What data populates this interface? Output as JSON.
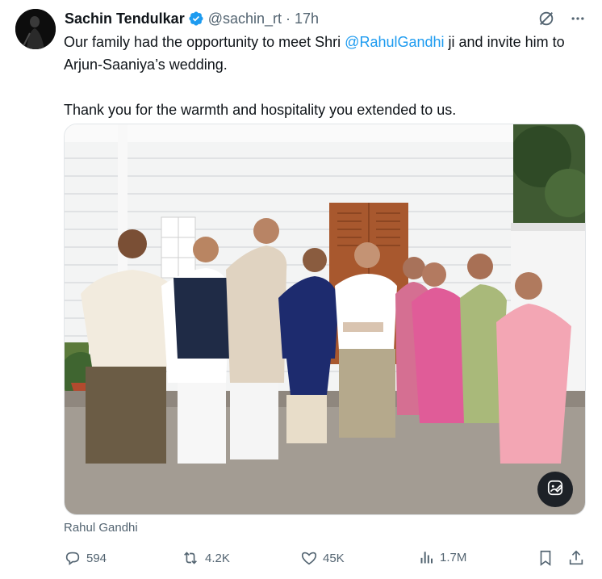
{
  "author": {
    "name": "Sachin Tendulkar",
    "handle": "@sachin_rt",
    "separator": "·",
    "time": "17h"
  },
  "tweet": {
    "text_before_mention": "Our family had the opportunity to meet Shri ",
    "mention": "@RahulGandhi",
    "text_after_mention": " ji and invite him to Arjun-Saaniya’s wedding.",
    "second_paragraph": "Thank you for the warmth and hospitality you extended to us."
  },
  "tagged_user": "Rahul Gandhi",
  "actions": {
    "replies": "594",
    "reposts": "4.2K",
    "likes": "45K",
    "views": "1.7M"
  },
  "icons": {
    "verified": "verified-badge-icon",
    "grok": "grok-icon",
    "more": "more-icon",
    "alt": "photo-info-icon",
    "reply": "reply-icon",
    "repost": "repost-icon",
    "like": "heart-icon",
    "views": "views-icon",
    "bookmark": "bookmark-icon",
    "share": "share-icon"
  },
  "colors": {
    "accent": "#1d9bf0",
    "text": "#0f1419",
    "muted": "#536471"
  }
}
